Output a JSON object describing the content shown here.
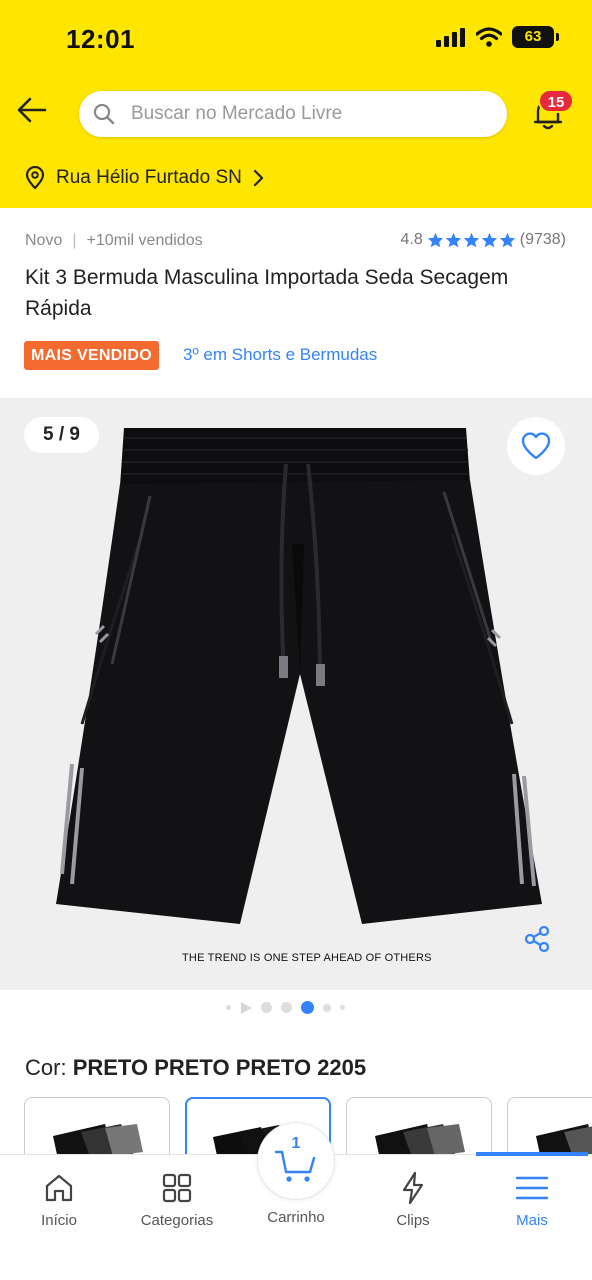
{
  "status_bar": {
    "time": "12:01",
    "battery": "63"
  },
  "header": {
    "search_placeholder": "Buscar no Mercado Livre",
    "notifications_count": "15",
    "address": "Rua Hélio Furtado SN"
  },
  "product": {
    "condition": "Novo",
    "sold": "+10mil vendidos",
    "rating": "4.8",
    "reviews": "(9738)",
    "title": "Kit 3 Bermuda Masculina Importada Seda Secagem Rápida",
    "badge": "MAIS VENDIDO",
    "rank": "3º em Shorts e Bermudas"
  },
  "gallery": {
    "counter": "5 / 9",
    "caption": "THE TREND IS ONE STEP AHEAD OF OTHERS",
    "total_images": 9,
    "current_index": 5
  },
  "color": {
    "label": "Cor:",
    "value": "PRETO PRETO PRETO 2205"
  },
  "bottom_nav": {
    "items": [
      {
        "label": "Início",
        "icon": "home-icon"
      },
      {
        "label": "Categorias",
        "icon": "grid-icon"
      },
      {
        "label": "Carrinho",
        "icon": "cart-icon"
      },
      {
        "label": "Clips",
        "icon": "lightning-icon"
      },
      {
        "label": "Mais",
        "icon": "menu-icon"
      }
    ],
    "cart_count": "1",
    "active": "Mais"
  },
  "colors": {
    "brand_yellow": "#FFE600",
    "accent_blue": "#3483FA",
    "badge_orange": "#F56A2F",
    "notification_red": "#E8283C"
  }
}
